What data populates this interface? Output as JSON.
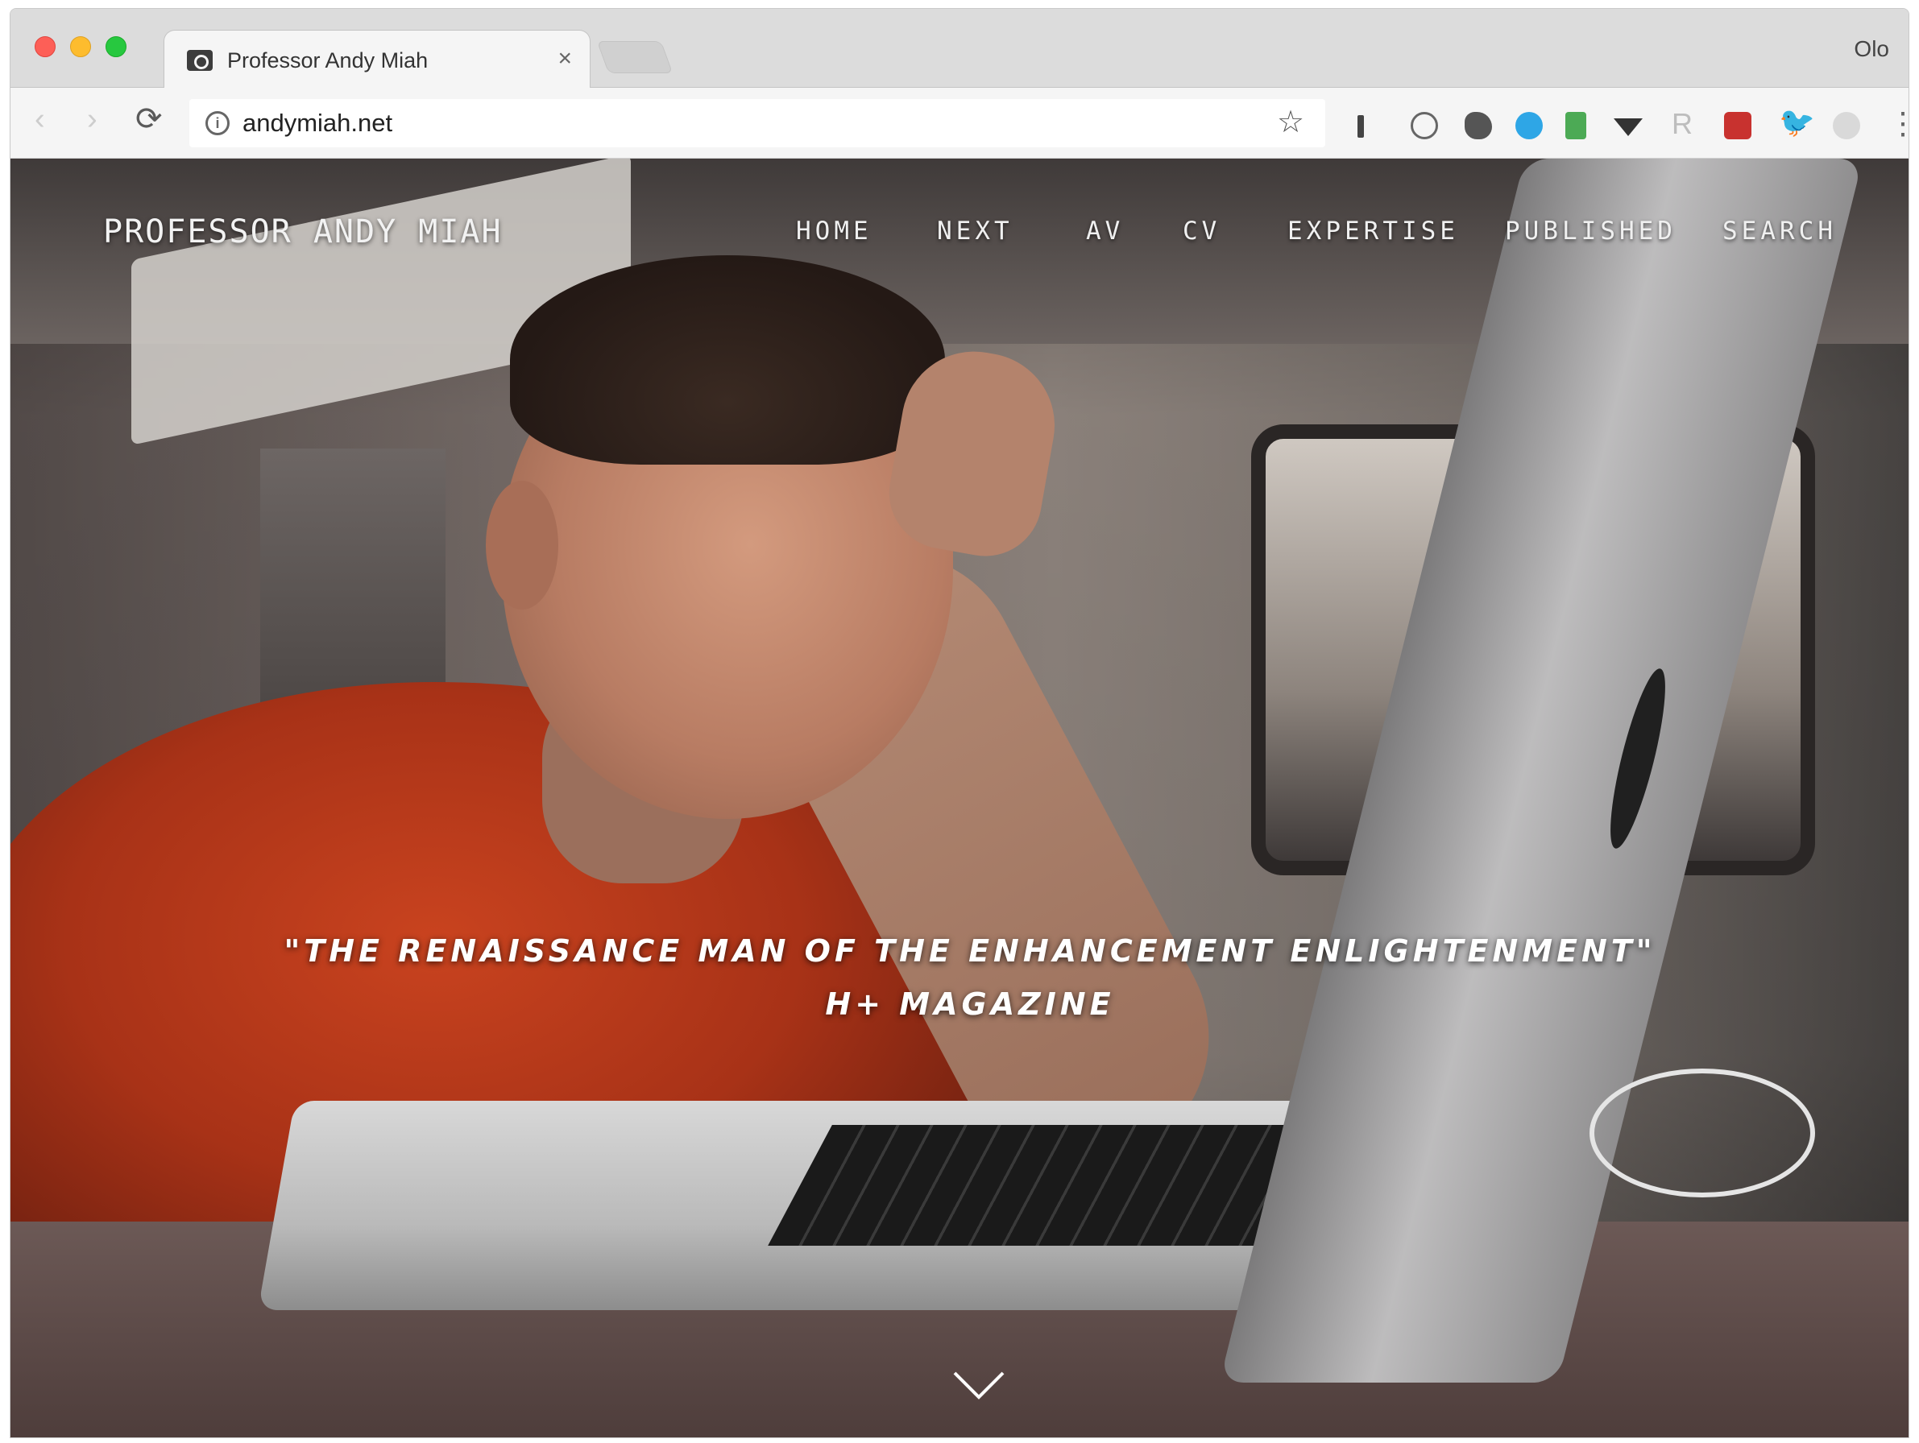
{
  "browser": {
    "tab": {
      "title": "Professor Andy Miah",
      "close": "×"
    },
    "profile": "Olo",
    "toolbar": {
      "back": "‹",
      "forward": "›",
      "reload": "⟳",
      "url": "andymiah.net",
      "star": "☆",
      "rss_ext": "R",
      "twitter_ext": "🐦",
      "menu": "⋮"
    }
  },
  "site": {
    "title": "PROFESSOR ANDY MIAH",
    "nav": [
      "HOME",
      "NEXT",
      "AV",
      "CV",
      "EXPERTISE",
      "PUBLISHED",
      "SEARCH"
    ]
  },
  "hero": {
    "quote": "\"THE RENAISSANCE MAN OF THE ENHANCEMENT ENLIGHTENMENT\"",
    "source": "H+ MAGAZINE"
  }
}
